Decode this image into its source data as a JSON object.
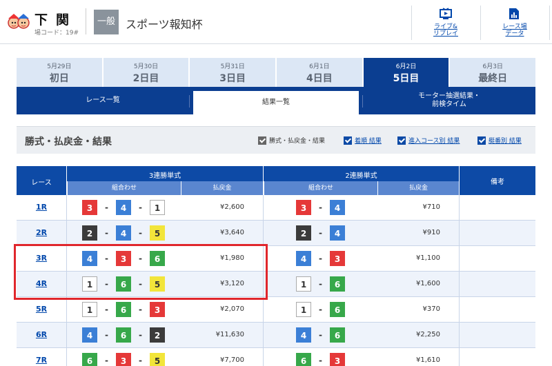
{
  "header": {
    "venue": "下関",
    "venue_code": "場コード：19#",
    "grade": "一般",
    "race_title": "スポーツ報知杯",
    "buttons": [
      {
        "label_line1": "ライブ&",
        "label_line2": "リプレイ",
        "icon": "tv-icon"
      },
      {
        "label_line1": "レース場",
        "label_line2": "データ",
        "icon": "chart-doc-icon"
      }
    ]
  },
  "days": [
    {
      "date": "5月29日",
      "name": "初日",
      "active": false
    },
    {
      "date": "5月30日",
      "name": "2日目",
      "active": false
    },
    {
      "date": "5月31日",
      "name": "3日目",
      "active": false
    },
    {
      "date": "6月1日",
      "name": "4日目",
      "active": false
    },
    {
      "date": "6月2日",
      "name": "5日目",
      "active": true
    },
    {
      "date": "6月3日",
      "name": "最終日",
      "active": false
    }
  ],
  "subtabs": {
    "race_list": "レース一覧",
    "results": "結果一覧",
    "motor_line1": "モーター抽選結果・",
    "motor_line2": "前検タイム"
  },
  "section": {
    "title": "勝式・払戻金・結果",
    "filters": [
      "勝式・払戻金・結果",
      "着順 結果",
      "進入コース別 結果",
      "艇番別 結果"
    ]
  },
  "table": {
    "col_race": "レース",
    "col_tri": "3連勝単式",
    "col_exa": "2連勝単式",
    "col_combo": "組合わせ",
    "col_pay": "払戻金",
    "col_note": "備考",
    "rows": [
      {
        "race": "1R",
        "tri": [
          3,
          4,
          1
        ],
        "tri_pay": "¥2,600",
        "exa": [
          3,
          4
        ],
        "exa_pay": "¥710"
      },
      {
        "race": "2R",
        "tri": [
          2,
          4,
          5
        ],
        "tri_pay": "¥3,640",
        "exa": [
          2,
          4
        ],
        "exa_pay": "¥910"
      },
      {
        "race": "3R",
        "tri": [
          4,
          3,
          6
        ],
        "tri_pay": "¥1,980",
        "exa": [
          4,
          3
        ],
        "exa_pay": "¥1,100"
      },
      {
        "race": "4R",
        "tri": [
          1,
          6,
          5
        ],
        "tri_pay": "¥3,120",
        "exa": [
          1,
          6
        ],
        "exa_pay": "¥1,600"
      },
      {
        "race": "5R",
        "tri": [
          1,
          6,
          3
        ],
        "tri_pay": "¥2,070",
        "exa": [
          1,
          6
        ],
        "exa_pay": "¥370"
      },
      {
        "race": "6R",
        "tri": [
          4,
          6,
          2
        ],
        "tri_pay": "¥11,630",
        "exa": [
          4,
          6
        ],
        "exa_pay": "¥2,250"
      },
      {
        "race": "7R",
        "tri": [
          6,
          3,
          5
        ],
        "tri_pay": "¥7,700",
        "exa": [
          6,
          3
        ],
        "exa_pay": "¥1,610"
      }
    ]
  },
  "colors": {
    "primary": "#0b3e91",
    "highlight": "#e0262c"
  }
}
